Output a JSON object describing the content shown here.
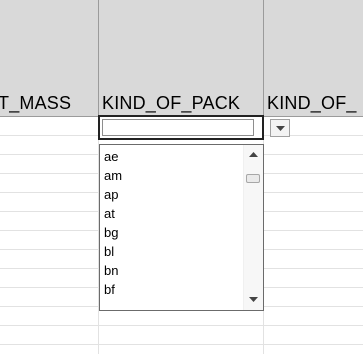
{
  "spreadsheet": {
    "columns": [
      {
        "label": "T_MASS"
      },
      {
        "label": "KIND_OF_PACK"
      },
      {
        "label": "KIND_OF_"
      }
    ],
    "active_cell": {
      "value": ""
    }
  },
  "dropdown": {
    "options": [
      "ae",
      "am",
      "ap",
      "at",
      "bg",
      "bl",
      "bn",
      "bf"
    ]
  }
}
